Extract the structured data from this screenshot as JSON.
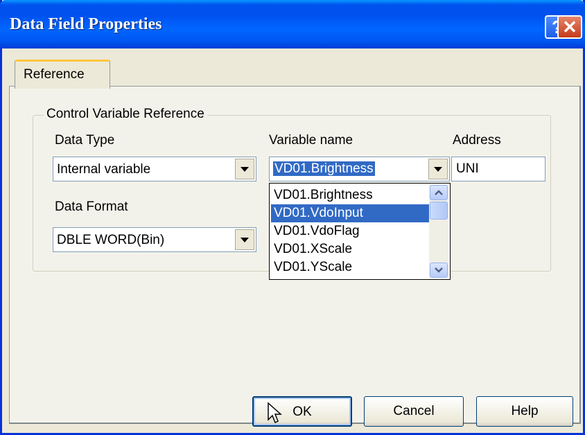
{
  "window": {
    "title": "Data Field Properties",
    "help_icon": "question-mark-icon",
    "close_icon": "close-x-icon"
  },
  "tabs": [
    {
      "label": "Reference",
      "active": true
    }
  ],
  "group": {
    "title": "Control Variable Reference"
  },
  "fields": {
    "data_type_label": "Data Type",
    "data_type_value": "Internal variable",
    "variable_name_label": "Variable name",
    "variable_name_value": "VD01.Brightness",
    "address_label": "Address",
    "address_value": "UNI",
    "data_format_label": "Data Format",
    "data_format_value": "DBLE WORD(Bin)"
  },
  "dropdown": {
    "items": [
      "VD01.Brightness",
      "VD01.VdoInput",
      "VD01.VdoFlag",
      "VD01.XScale",
      "VD01.YScale"
    ],
    "highlighted_index": 1
  },
  "buttons": {
    "ok": "OK",
    "cancel": "Cancel",
    "help": "Help"
  },
  "colors": {
    "titlebar": "#0054e3",
    "selection": "#316ac5",
    "tab_highlight": "#ffc83c"
  }
}
